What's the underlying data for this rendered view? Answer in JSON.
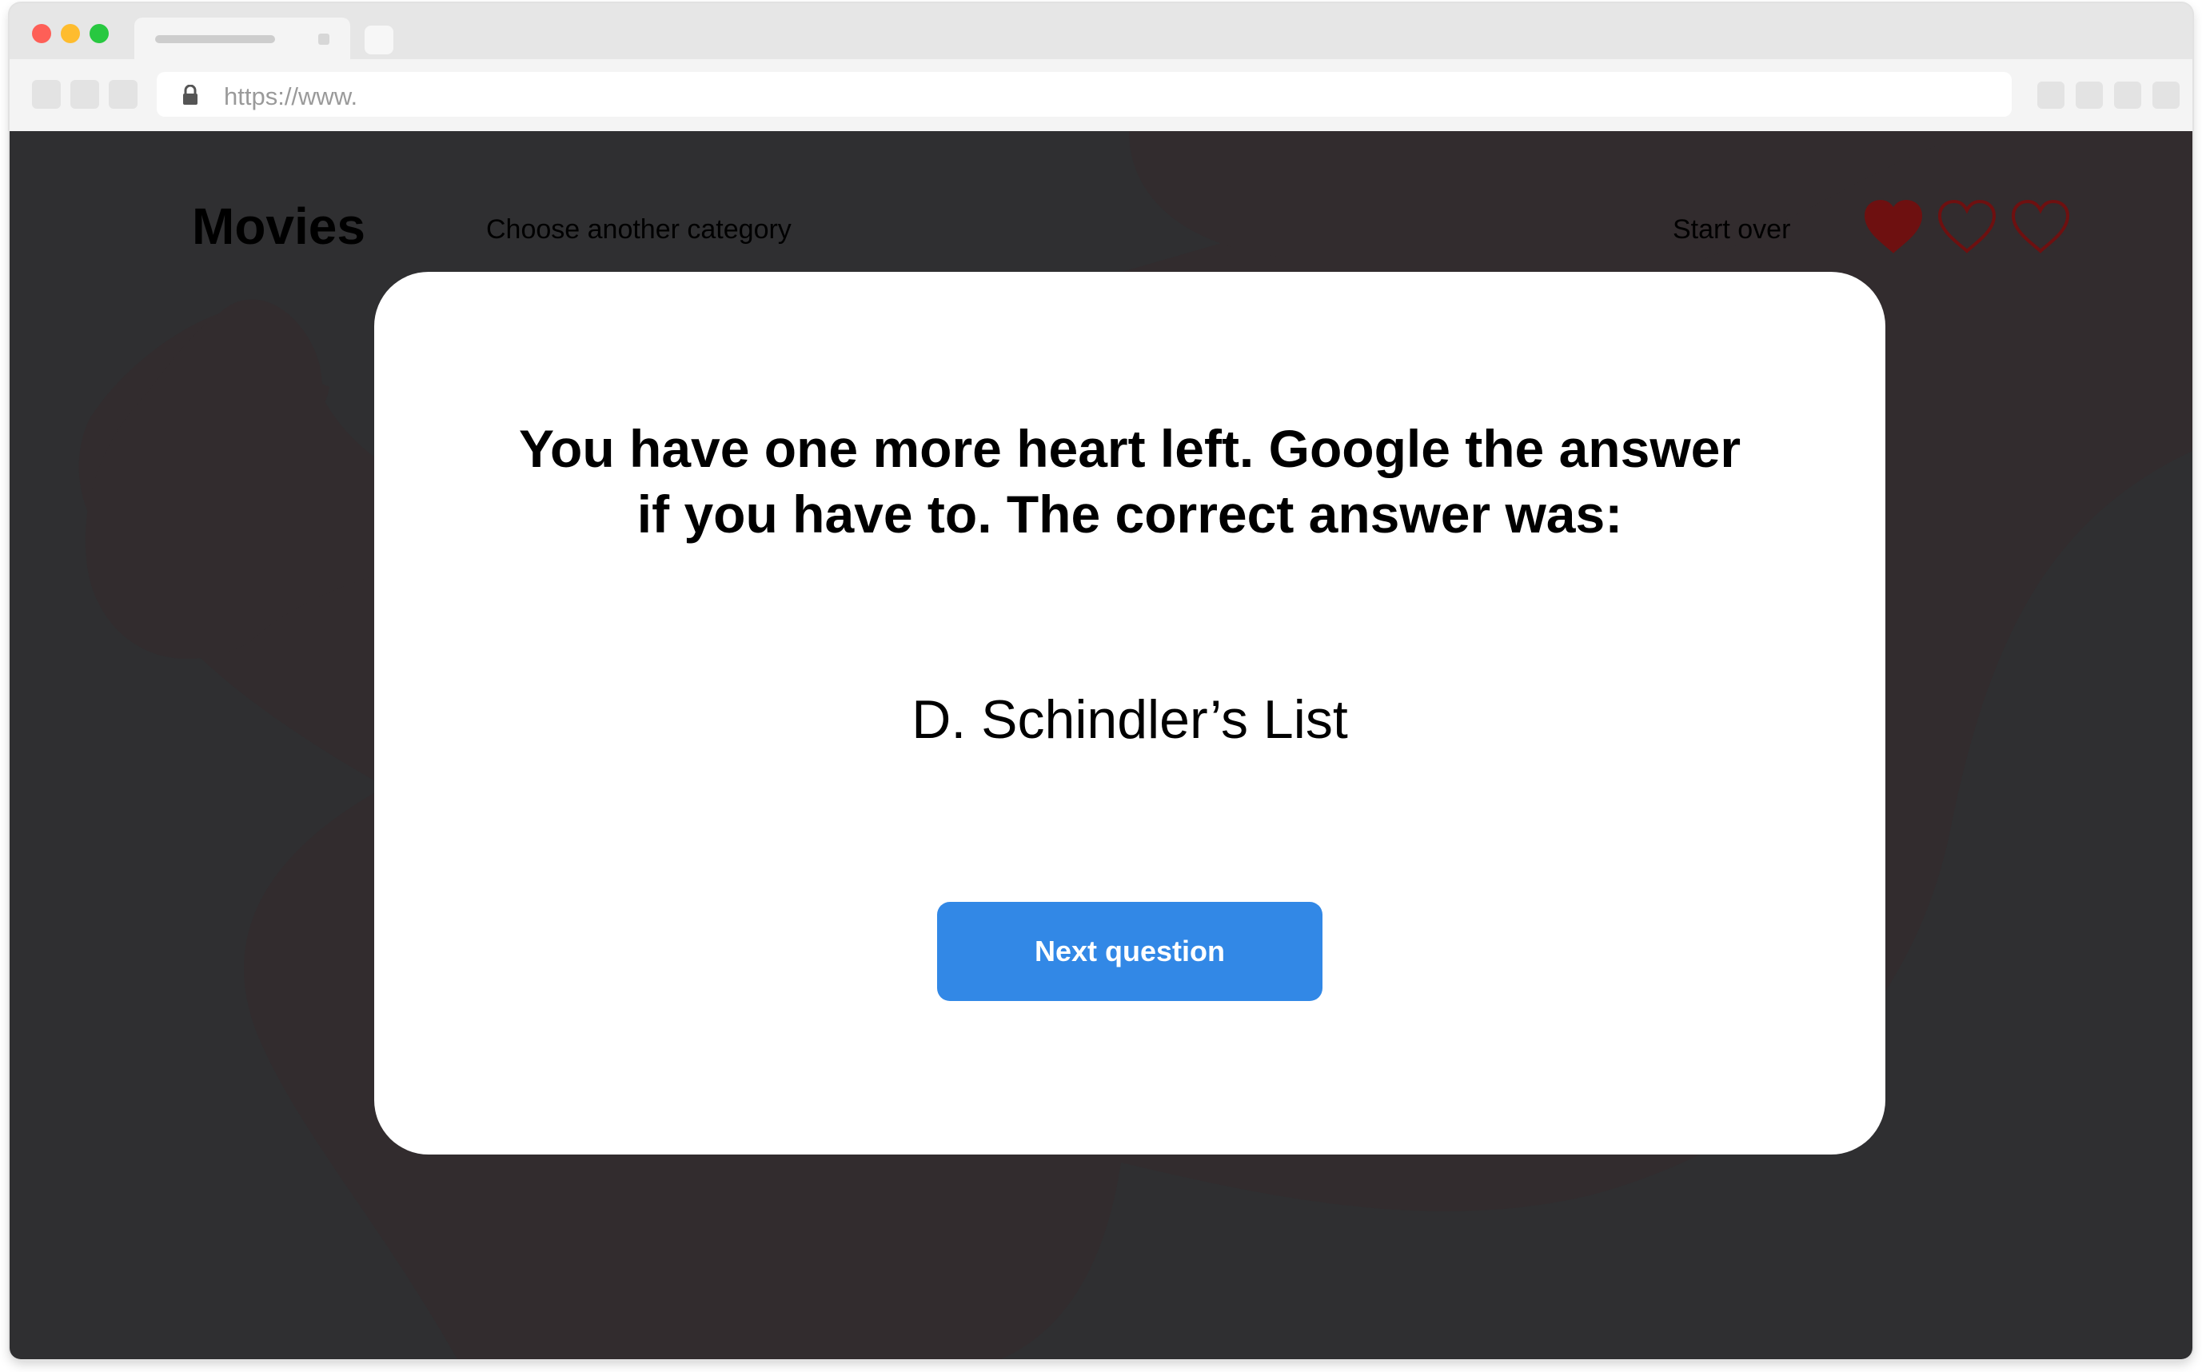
{
  "browser": {
    "url": "https://www."
  },
  "header": {
    "brand": "Movies",
    "choose_category": "Choose another category",
    "start_over": "Start over"
  },
  "lives": {
    "total": 3,
    "filled": 1,
    "filled_color": "#6e1010",
    "outline_color": "#6e1010"
  },
  "modal": {
    "message": "You have one more heart left. Google the answer if you have to. The correct answer was:",
    "answer": "D. Schindler’s List",
    "next_button": "Next question"
  },
  "colors": {
    "page_background": "#2f2f31",
    "blob": "#322c2e",
    "button": "#3288e6"
  }
}
